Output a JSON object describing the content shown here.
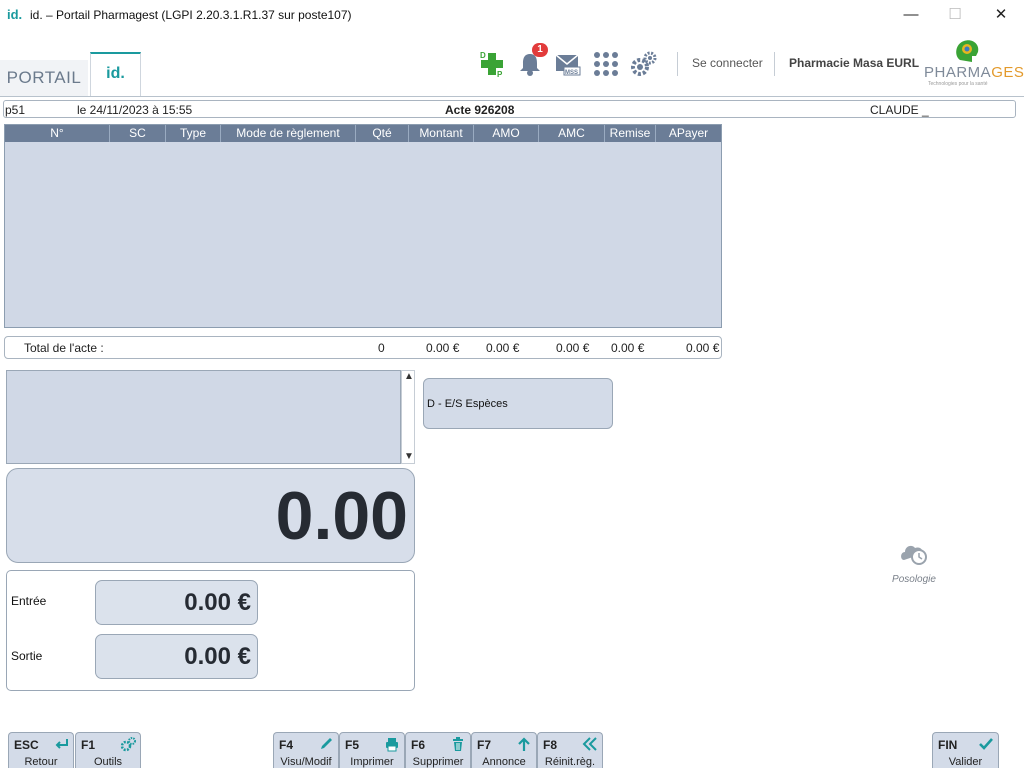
{
  "window": {
    "logo": "id.",
    "title": "id. – Portail Pharmagest (LGPI 2.20.3.1.R1.37 sur poste107)"
  },
  "header": {
    "tab_portail": "PORTAIL",
    "tab_id": "id.",
    "notification_count": "1",
    "connect_label": "Se connecter",
    "pharmacy_name": "Pharmacie Masa EURL",
    "logo_pharma": "PHARMA",
    "logo_gest": "GEST",
    "logo_tagline": "Technologies pour la santé"
  },
  "info": {
    "poste": "p51",
    "date": "le 24/11/2023 à 15:55",
    "acte": "Acte 926208",
    "client": "CLAUDE _"
  },
  "table": {
    "columns": [
      "N°",
      "SC",
      "Type",
      "Mode de règlement",
      "Qté",
      "Montant",
      "AMO",
      "AMC",
      "Remise",
      "APayer"
    ],
    "rows": []
  },
  "total": {
    "label": "Total de l'acte :",
    "qte": "0",
    "montant": "0.00 €",
    "amo": "0.00 €",
    "amc": "0.00 €",
    "remise": "0.00 €",
    "apayer": "0.00 €"
  },
  "amount": "0.00",
  "entree": {
    "label": "Entrée",
    "value": "0.00 €"
  },
  "sortie": {
    "label": "Sortie",
    "value": "0.00 €"
  },
  "especes_button": "D - E/S Espèces",
  "posologie_label": "Posologie",
  "fkeys": {
    "esc": {
      "key": "ESC",
      "label": "Retour",
      "icon": "return-icon"
    },
    "f1": {
      "key": "F1",
      "label": "Outils",
      "icon": "gears-icon"
    },
    "f4": {
      "key": "F4",
      "label": "Visu/Modif",
      "icon": "pencil-icon"
    },
    "f5": {
      "key": "F5",
      "label": "Imprimer",
      "icon": "printer-icon"
    },
    "f6": {
      "key": "F6",
      "label": "Supprimer",
      "icon": "trash-icon"
    },
    "f7": {
      "key": "F7",
      "label": "Annonce",
      "icon": "arrow-up-icon"
    },
    "f8": {
      "key": "F8",
      "label": "Réinit.règ.",
      "icon": "double-chevron-left-icon"
    },
    "fin": {
      "key": "FIN",
      "label": "Valider",
      "icon": "check-icon"
    }
  },
  "colors": {
    "accent": "#1a9a9e",
    "header_row": "#6b7d97",
    "panel": "#d0d8e6",
    "badge": "#e23b3b",
    "dp_green": "#3aa335"
  }
}
